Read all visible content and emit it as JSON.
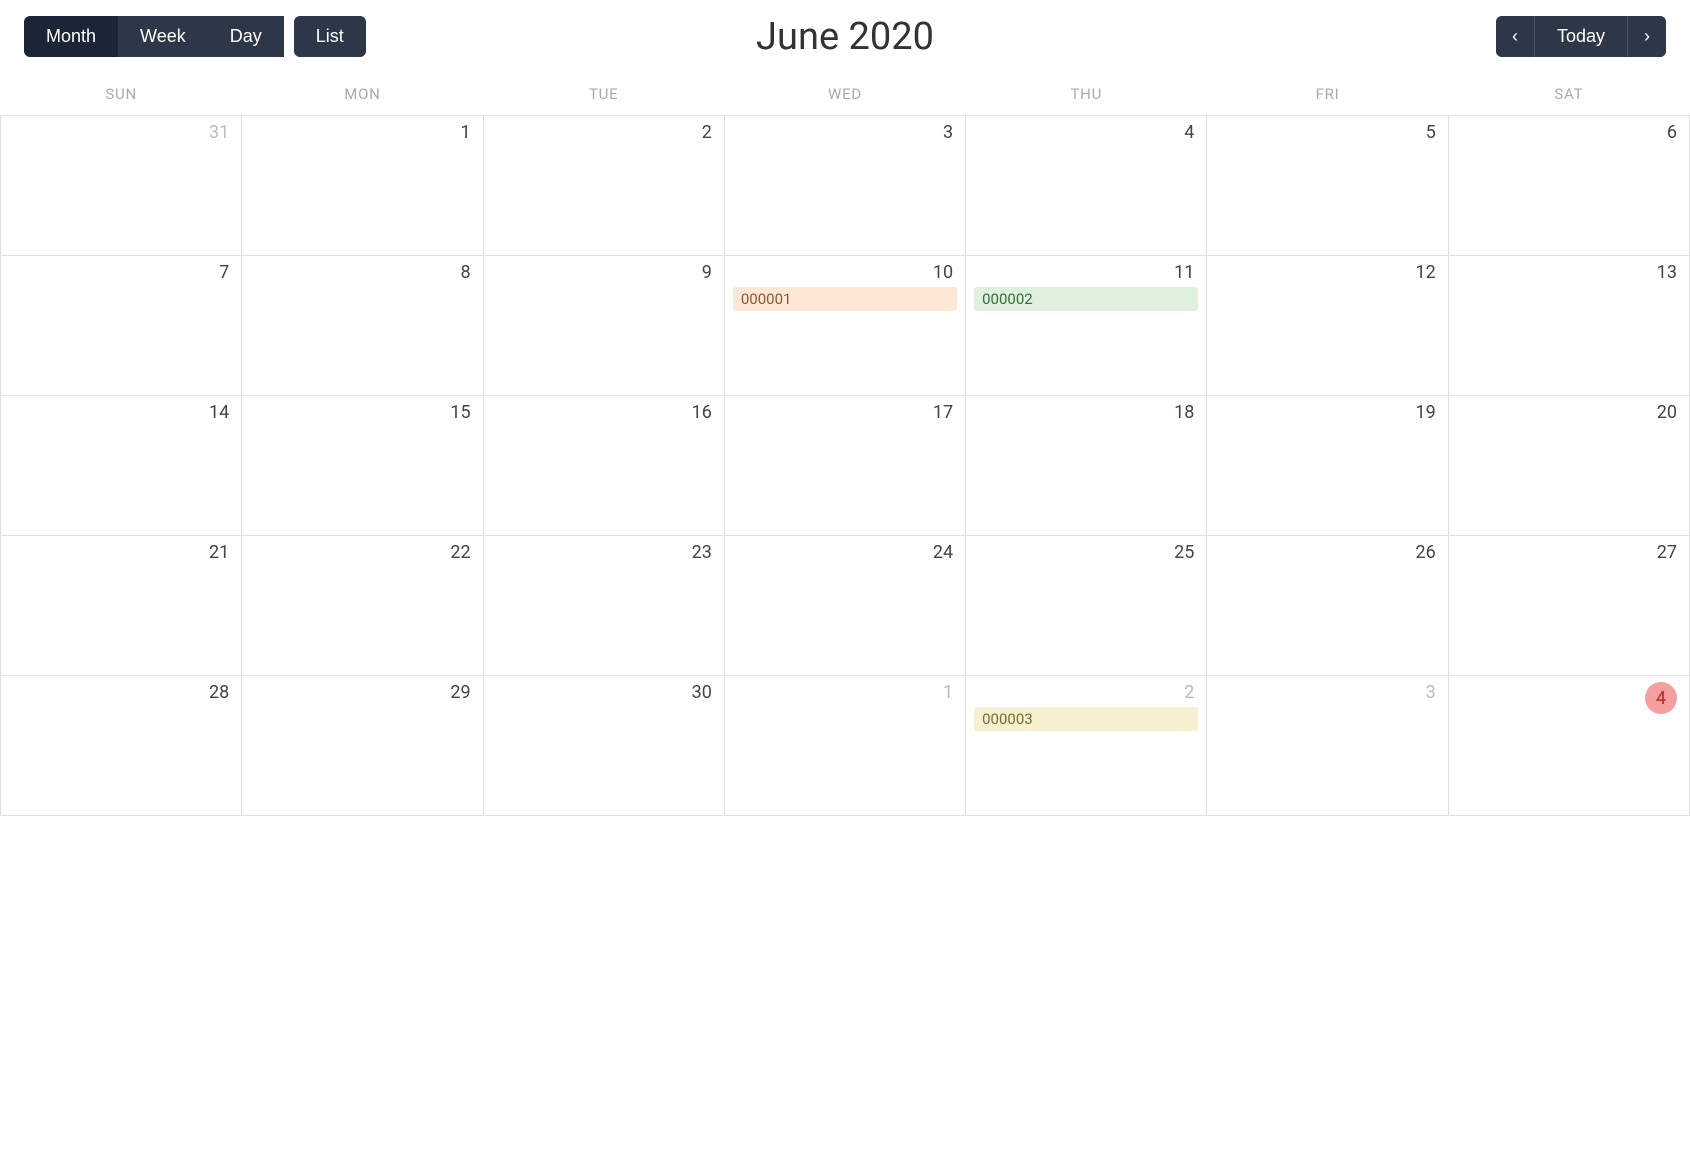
{
  "header": {
    "title": "June 2020",
    "view_buttons": [
      {
        "label": "Month",
        "key": "month",
        "active": true
      },
      {
        "label": "Week",
        "key": "week",
        "active": false
      },
      {
        "label": "Day",
        "key": "day",
        "active": false
      },
      {
        "label": "List",
        "key": "list",
        "active": false
      }
    ],
    "nav": {
      "prev_label": "‹",
      "today_label": "Today",
      "next_label": "›"
    }
  },
  "calendar": {
    "day_headers": [
      "SUN",
      "MON",
      "TUE",
      "WED",
      "THU",
      "FRI",
      "SAT"
    ],
    "weeks": [
      [
        {
          "day": "31",
          "outside": true,
          "events": []
        },
        {
          "day": "1",
          "outside": false,
          "events": []
        },
        {
          "day": "2",
          "outside": false,
          "events": []
        },
        {
          "day": "3",
          "outside": false,
          "events": []
        },
        {
          "day": "4",
          "outside": false,
          "events": []
        },
        {
          "day": "5",
          "outside": false,
          "events": []
        },
        {
          "day": "6",
          "outside": false,
          "events": []
        }
      ],
      [
        {
          "day": "7",
          "outside": false,
          "events": []
        },
        {
          "day": "8",
          "outside": false,
          "events": []
        },
        {
          "day": "9",
          "outside": false,
          "events": []
        },
        {
          "day": "10",
          "outside": false,
          "events": [
            {
              "label": "000001",
              "color": "orange"
            }
          ]
        },
        {
          "day": "11",
          "outside": false,
          "events": [
            {
              "label": "000002",
              "color": "green"
            }
          ]
        },
        {
          "day": "12",
          "outside": false,
          "events": []
        },
        {
          "day": "13",
          "outside": false,
          "events": []
        }
      ],
      [
        {
          "day": "14",
          "outside": false,
          "events": []
        },
        {
          "day": "15",
          "outside": false,
          "events": []
        },
        {
          "day": "16",
          "outside": false,
          "events": []
        },
        {
          "day": "17",
          "outside": false,
          "events": []
        },
        {
          "day": "18",
          "outside": false,
          "events": []
        },
        {
          "day": "19",
          "outside": false,
          "events": []
        },
        {
          "day": "20",
          "outside": false,
          "events": []
        }
      ],
      [
        {
          "day": "21",
          "outside": false,
          "events": []
        },
        {
          "day": "22",
          "outside": false,
          "events": []
        },
        {
          "day": "23",
          "outside": false,
          "events": []
        },
        {
          "day": "24",
          "outside": false,
          "events": []
        },
        {
          "day": "25",
          "outside": false,
          "events": []
        },
        {
          "day": "26",
          "outside": false,
          "events": []
        },
        {
          "day": "27",
          "outside": false,
          "events": []
        }
      ],
      [
        {
          "day": "28",
          "outside": false,
          "events": []
        },
        {
          "day": "29",
          "outside": false,
          "events": []
        },
        {
          "day": "30",
          "outside": false,
          "events": []
        },
        {
          "day": "1",
          "outside": true,
          "events": []
        },
        {
          "day": "2",
          "outside": true,
          "events": []
        },
        {
          "day": "3",
          "outside": true,
          "events": []
        },
        {
          "day": "4",
          "outside": false,
          "today": true,
          "events": []
        }
      ]
    ],
    "special_events": {
      "week2_thu": {
        "label": "000003",
        "color": "yellow",
        "day": "2",
        "week": 4
      }
    }
  }
}
